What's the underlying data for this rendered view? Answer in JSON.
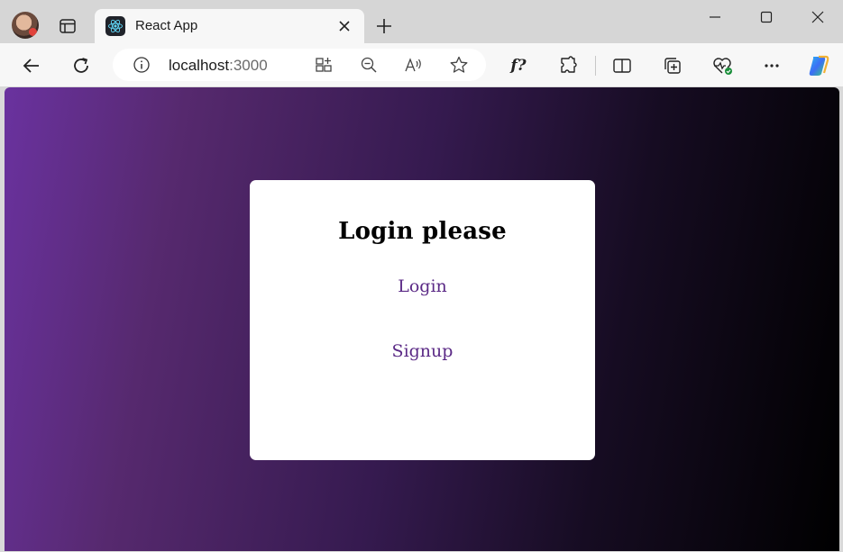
{
  "browser": {
    "tab": {
      "title": "React App",
      "favicon": "react-icon"
    },
    "address": {
      "host": "localhost",
      "port": ":3000"
    },
    "icons": {
      "back": "arrow-left-icon",
      "refresh": "refresh-icon",
      "info": "info-icon",
      "split": "split-screen-icon",
      "zoom": "zoom-out-icon",
      "read_aloud": "read-aloud-icon",
      "favorite": "star-icon",
      "formula": "f?",
      "extensions": "puzzle-icon",
      "split_window": "split-window-icon",
      "collections": "collections-icon",
      "health": "heart-pulse-icon",
      "more": "more-icon",
      "copilot": "copilot-icon"
    },
    "colors": {
      "tabstrip": "#d6d6d6",
      "toolbar": "#f7f7f7"
    }
  },
  "page": {
    "heading": "Login please",
    "links": {
      "login": "Login",
      "signup": "Signup"
    },
    "colors": {
      "gradient_start": "#6a329f",
      "gradient_end": "#000000",
      "link": "#5b2a86",
      "card": "#ffffff"
    }
  }
}
